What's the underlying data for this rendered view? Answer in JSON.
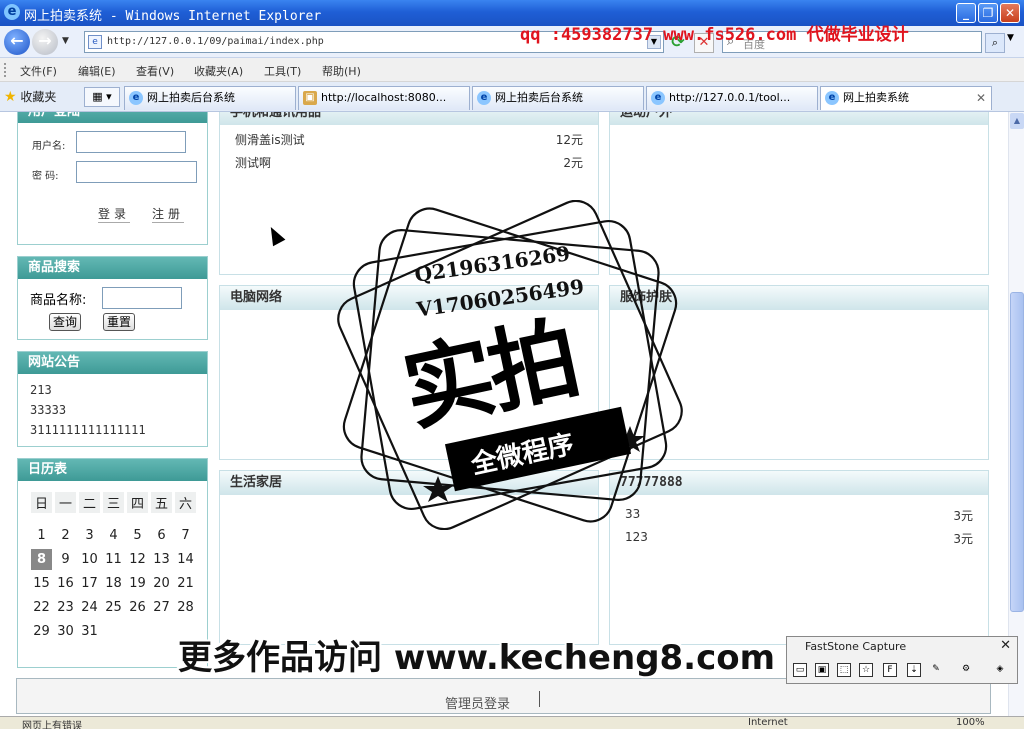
{
  "window": {
    "title": "网上拍卖系统 - Windows Internet Explorer"
  },
  "address": {
    "url": "http://127.0.0.1/09/paimai/index.php",
    "search_placeholder": "百度"
  },
  "top_watermark": "qq :459382737 www.fs526.com 代做毕业设计",
  "menu": [
    "文件(F)",
    "编辑(E)",
    "查看(V)",
    "收藏夹(A)",
    "工具(T)",
    "帮助(H)"
  ],
  "favorites_label": "收藏夹",
  "tabs": [
    {
      "label": "网上拍卖后台系统"
    },
    {
      "label": "http://localhost:8080..."
    },
    {
      "label": "网上拍卖后台系统"
    },
    {
      "label": "http://127.0.0.1/tool..."
    },
    {
      "label": "网上拍卖系统"
    }
  ],
  "login": {
    "title": "用户登陆",
    "username_label": "用户名:",
    "password_label": "密  码:",
    "login_button": "登录",
    "register_button": "注册"
  },
  "search": {
    "title": "商品搜索",
    "name_label": "商品名称:",
    "query_button": "查询",
    "reset_button": "重置"
  },
  "notices": {
    "title": "网站公告",
    "items": [
      "213",
      "33333",
      "3111111111111111"
    ]
  },
  "calendar": {
    "title": "日历表",
    "weekdays": [
      "日",
      "一",
      "二",
      "三",
      "四",
      "五",
      "六"
    ],
    "weeks": [
      [
        "1",
        "2",
        "3",
        "4",
        "5",
        "6",
        "7"
      ],
      [
        "8",
        "9",
        "10",
        "11",
        "12",
        "13",
        "14"
      ],
      [
        "15",
        "16",
        "17",
        "18",
        "19",
        "20",
        "21"
      ],
      [
        "22",
        "23",
        "24",
        "25",
        "26",
        "27",
        "28"
      ],
      [
        "29",
        "30",
        "31",
        "",
        "",
        "",
        ""
      ]
    ],
    "today": "8"
  },
  "categories": [
    {
      "title": "手机和通讯用品",
      "items": [
        {
          "name": "侧滑盖is测试",
          "price": "12元"
        },
        {
          "name": "测试啊",
          "price": "2元"
        }
      ]
    },
    {
      "title": "运动户外",
      "items": []
    },
    {
      "title": "电脑网络",
      "items": []
    },
    {
      "title": "服饰护肤",
      "items": []
    },
    {
      "title": "生活家居",
      "items": []
    },
    {
      "title": "77777888",
      "items": [
        {
          "name": "33",
          "price": "3元"
        },
        {
          "name": "123",
          "price": "3元"
        }
      ]
    }
  ],
  "footer": {
    "admin_login": "管理员登录"
  },
  "stamp": {
    "qq": "Q2196316269",
    "v": "V17060256499",
    "main": "实拍",
    "ribbon": "全微程序"
  },
  "bottom_watermark": "更多作品访问 www.kecheng8.com",
  "faststone": {
    "title": "FastStone Capture"
  },
  "status": {
    "text": "网页上有错误",
    "zone": "Internet",
    "zoom": "100%"
  }
}
